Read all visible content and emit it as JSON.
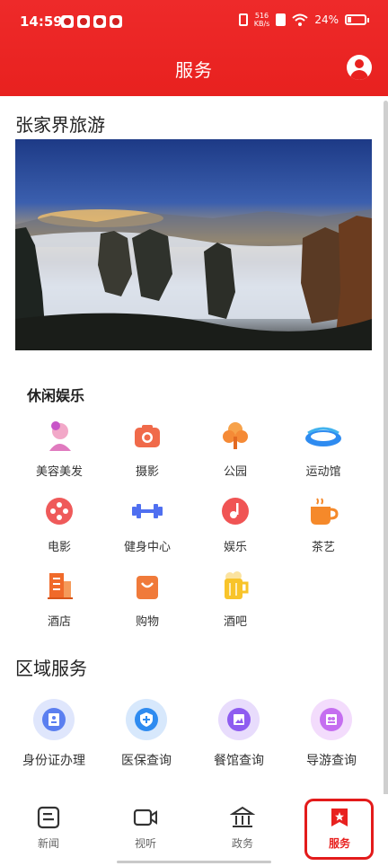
{
  "status_bar": {
    "time": "14:59",
    "speed_value": "516",
    "speed_unit": "KB/s",
    "battery": "24%",
    "battery_level": 0.24
  },
  "header": {
    "title": "服务",
    "profile_icon": "profile-icon"
  },
  "attraction": {
    "title": "张家界旅游"
  },
  "leisure": {
    "title": "休闲娱乐",
    "items": [
      {
        "label": "美容美发",
        "icon": "beauty-icon"
      },
      {
        "label": "摄影",
        "icon": "camera-icon"
      },
      {
        "label": "公园",
        "icon": "tree-icon"
      },
      {
        "label": "运动馆",
        "icon": "stadium-icon"
      },
      {
        "label": "电影",
        "icon": "film-reel-icon"
      },
      {
        "label": "健身中心",
        "icon": "dumbbell-icon"
      },
      {
        "label": "娱乐",
        "icon": "music-icon"
      },
      {
        "label": "茶艺",
        "icon": "tea-cup-icon"
      },
      {
        "label": "酒店",
        "icon": "hotel-icon"
      },
      {
        "label": "购物",
        "icon": "shopping-bag-icon"
      },
      {
        "label": "酒吧",
        "icon": "beer-icon"
      }
    ]
  },
  "regional": {
    "title": "区域服务",
    "items": [
      {
        "label": "身份证办理",
        "icon": "id-card-icon",
        "color": "#5b7ff0"
      },
      {
        "label": "医保查询",
        "icon": "shield-icon",
        "color": "#2e8bf0"
      },
      {
        "label": "餐馆查询",
        "icon": "restaurant-icon",
        "color": "#8e5cf0"
      },
      {
        "label": "导游查询",
        "icon": "guide-icon",
        "color": "#c56ef0"
      }
    ]
  },
  "tabbar": {
    "tabs": [
      {
        "label": "新闻",
        "icon": "news-icon"
      },
      {
        "label": "视听",
        "icon": "video-icon"
      },
      {
        "label": "政务",
        "icon": "government-icon"
      },
      {
        "label": "服务",
        "icon": "service-icon",
        "active": true
      }
    ]
  },
  "colors": {
    "brand_red": "#e8211f"
  }
}
